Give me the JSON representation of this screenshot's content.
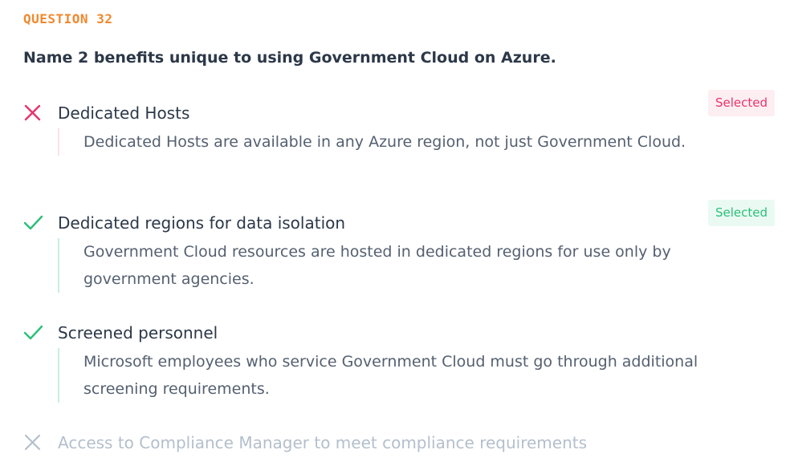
{
  "question": {
    "number_label": "QUESTION 32",
    "text": "Name 2 benefits unique to using Government Cloud on Azure."
  },
  "options": [
    {
      "label": "Dedicated Hosts",
      "status": "incorrect",
      "selected": true,
      "badge": "Selected",
      "explanation": "Dedicated Hosts are available in any Azure region, not just Government Cloud."
    },
    {
      "label": "Dedicated regions for data isolation",
      "status": "correct",
      "selected": true,
      "badge": "Selected",
      "explanation": "Government Cloud resources are hosted in dedicated regions for use only by government agencies."
    },
    {
      "label": "Screened personnel",
      "status": "correct",
      "selected": false,
      "explanation": "Microsoft employees who service Government Cloud must go through additional screening requirements."
    },
    {
      "label": "Access to Compliance Manager to meet compliance requirements",
      "status": "incorrect",
      "selected": false
    }
  ],
  "colors": {
    "accent_orange": "#f0892e",
    "incorrect": "#e8336a",
    "correct": "#2bbf78",
    "muted": "#b4bfcc"
  }
}
